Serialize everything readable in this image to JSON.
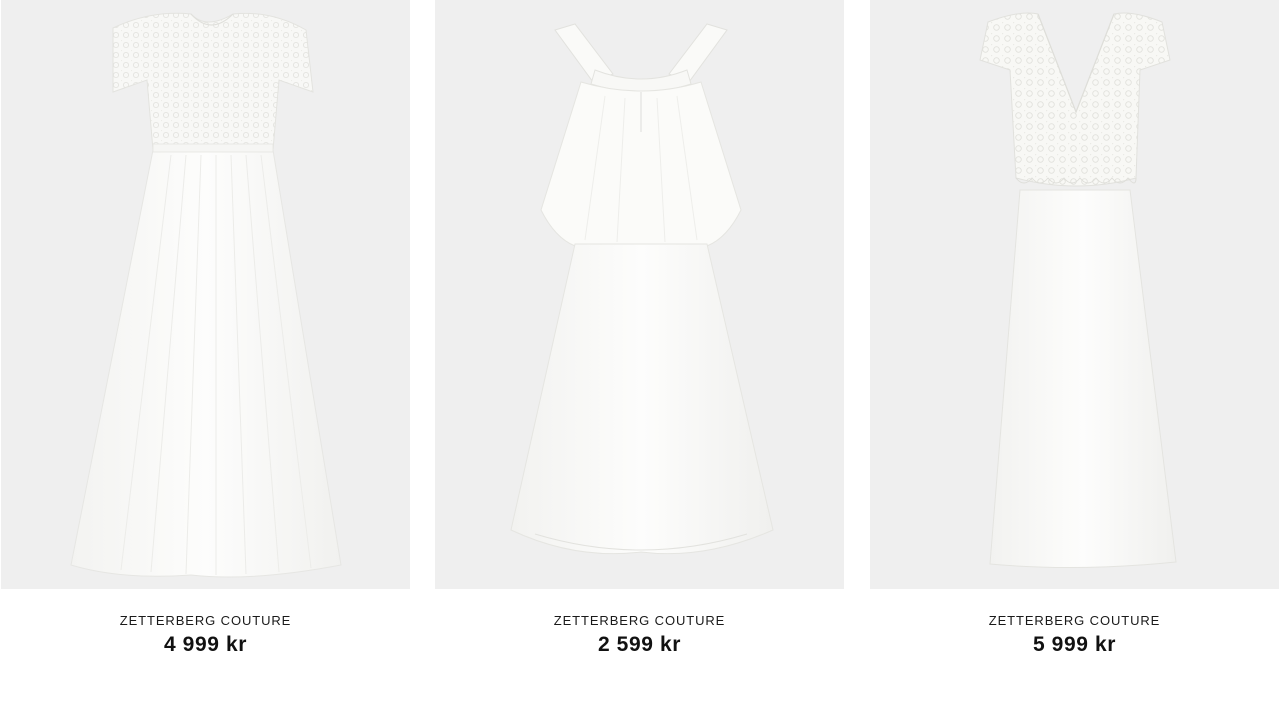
{
  "products": [
    {
      "brand": "ZETTERBERG COUTURE",
      "price": "4 999 kr",
      "image_icon": "lace-maxi-dress-image"
    },
    {
      "brand": "ZETTERBERG COUTURE",
      "price": "2 599 kr",
      "image_icon": "halter-midi-dress-image"
    },
    {
      "brand": "ZETTERBERG COUTURE",
      "price": "5 999 kr",
      "image_icon": "lace-top-column-dress-image"
    }
  ],
  "colors": {
    "image_background": "#efefef",
    "dress_white": "#fbfbf9",
    "text": "#111111"
  }
}
